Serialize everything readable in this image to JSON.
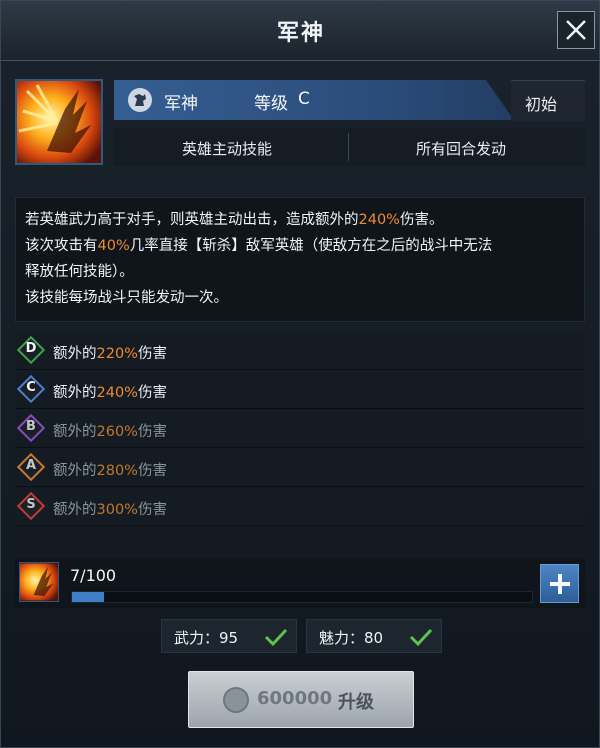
{
  "window": {
    "title": "军神"
  },
  "skill": {
    "icon": "flame-wing-icon",
    "name": "军神",
    "grade_label": "等级",
    "grade_value": "C",
    "initial_tag": "初始",
    "type": "英雄主动技能",
    "trigger": "所有回合发动"
  },
  "description": {
    "line1_pre": "若英雄武力高于对手，则英雄主动出击，造成额外的",
    "line1_value": "240%",
    "line1_post": "伤害。",
    "line2_pre": "该次攻击有",
    "line2_value": "40%",
    "line2_post": "几率直接【斩杀】敌军英雄（使敌方在之后的战斗中无法",
    "line3": "释放任何技能）。",
    "line4": "该技能每场战斗只能发动一次。"
  },
  "tiers": [
    {
      "grade": "D",
      "prefix": "额外的",
      "value": "220%",
      "suffix": "伤害",
      "color": "#3fa34a",
      "active": true
    },
    {
      "grade": "C",
      "prefix": "额外的",
      "value": "240%",
      "suffix": "伤害",
      "color": "#4a7fd0",
      "active": true
    },
    {
      "grade": "B",
      "prefix": "额外的",
      "value": "260%",
      "suffix": "伤害",
      "color": "#8a4bbf",
      "active": false
    },
    {
      "grade": "A",
      "prefix": "额外的",
      "value": "280%",
      "suffix": "伤害",
      "color": "#c9782e",
      "active": false
    },
    {
      "grade": "S",
      "prefix": "额外的",
      "value": "300%",
      "suffix": "伤害",
      "color": "#c43a35",
      "active": false
    }
  ],
  "progress": {
    "text": "7/100",
    "fraction": 0.07
  },
  "stats": {
    "force": "武力：95",
    "charm": "魅力：80"
  },
  "upgrade": {
    "cost": "600000",
    "label": "升级"
  },
  "colors": {
    "highlight": "#f08a30",
    "accent": "#3e7fc8"
  }
}
